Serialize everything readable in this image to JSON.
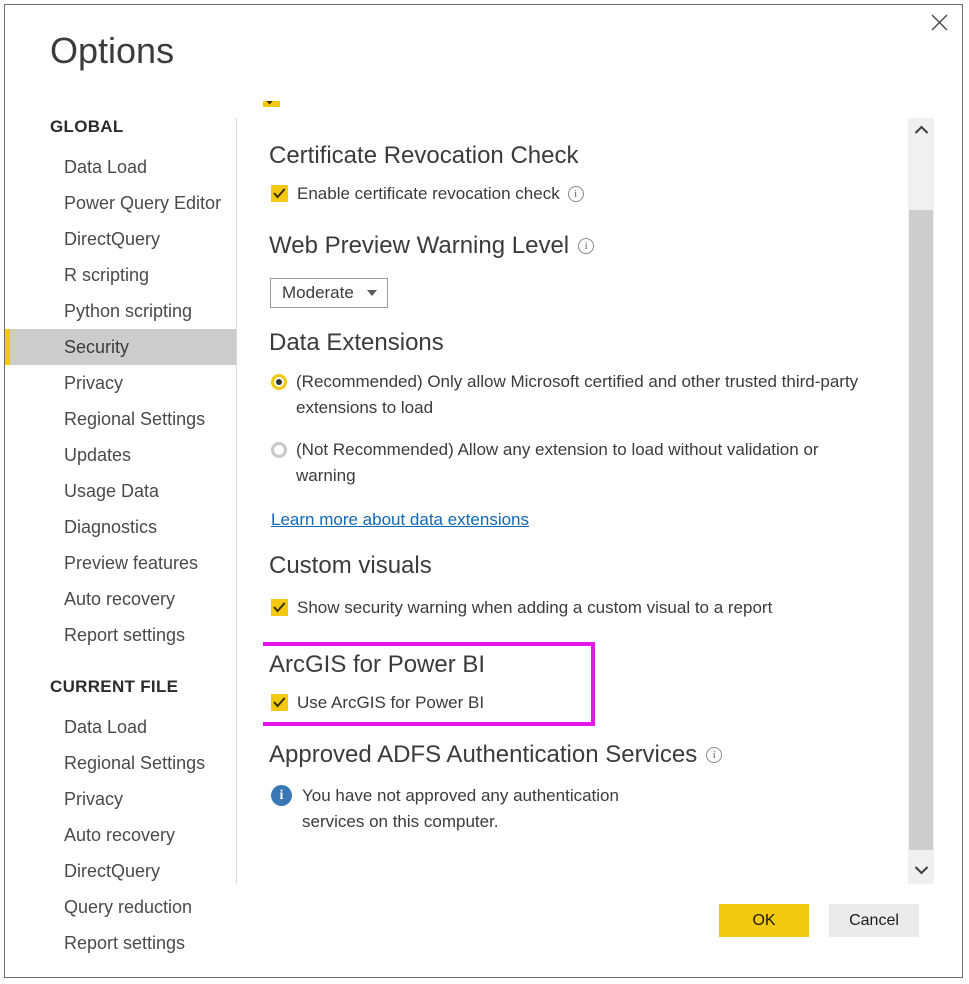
{
  "dialog": {
    "title": "Options",
    "close_icon": "close-icon"
  },
  "sidebar": {
    "groups": [
      {
        "heading": "GLOBAL",
        "items": [
          {
            "label": "Data Load",
            "selected": false
          },
          {
            "label": "Power Query Editor",
            "selected": false
          },
          {
            "label": "DirectQuery",
            "selected": false
          },
          {
            "label": "R scripting",
            "selected": false
          },
          {
            "label": "Python scripting",
            "selected": false
          },
          {
            "label": "Security",
            "selected": true
          },
          {
            "label": "Privacy",
            "selected": false
          },
          {
            "label": "Regional Settings",
            "selected": false
          },
          {
            "label": "Updates",
            "selected": false
          },
          {
            "label": "Usage Data",
            "selected": false
          },
          {
            "label": "Diagnostics",
            "selected": false
          },
          {
            "label": "Preview features",
            "selected": false
          },
          {
            "label": "Auto recovery",
            "selected": false
          },
          {
            "label": "Report settings",
            "selected": false
          }
        ]
      },
      {
        "heading": "CURRENT FILE",
        "items": [
          {
            "label": "Data Load",
            "selected": false
          },
          {
            "label": "Regional Settings",
            "selected": false
          },
          {
            "label": "Privacy",
            "selected": false
          },
          {
            "label": "Auto recovery",
            "selected": false
          },
          {
            "label": "DirectQuery",
            "selected": false
          },
          {
            "label": "Query reduction",
            "selected": false
          },
          {
            "label": "Report settings",
            "selected": false
          }
        ]
      }
    ]
  },
  "content": {
    "certificate_revocation": {
      "title": "Certificate Revocation Check",
      "checkbox_label": "Enable certificate revocation check",
      "checked": true,
      "info_icon": "info-icon"
    },
    "web_preview": {
      "title": "Web Preview Warning Level",
      "info_icon": "info-icon",
      "dropdown_value": "Moderate",
      "dropdown_icon": "chevron-down-icon"
    },
    "data_extensions": {
      "title": "Data Extensions",
      "options": [
        {
          "label": "(Recommended) Only allow Microsoft certified and other trusted third-party extensions to load",
          "selected": true
        },
        {
          "label": "(Not Recommended) Allow any extension to load without validation or warning",
          "selected": false
        }
      ],
      "link_text": "Learn more about data extensions"
    },
    "custom_visuals": {
      "title": "Custom visuals",
      "checkbox_label": "Show security warning when adding a custom visual to a report",
      "checked": true
    },
    "arcgis": {
      "title": "ArcGIS for Power BI",
      "checkbox_label": "Use ArcGIS for Power BI",
      "checked": true,
      "highlight_color": "#e815e8"
    },
    "adfs": {
      "title": "Approved ADFS Authentication Services",
      "info_icon": "info-icon",
      "message": "You have not approved any authentication services on this computer.",
      "message_icon": "info-filled-icon"
    }
  },
  "scrollbar": {
    "up_icon": "chevron-up-icon",
    "down_icon": "chevron-down-icon"
  },
  "footer": {
    "ok_label": "OK",
    "cancel_label": "Cancel",
    "ok_color": "#f2c811"
  }
}
